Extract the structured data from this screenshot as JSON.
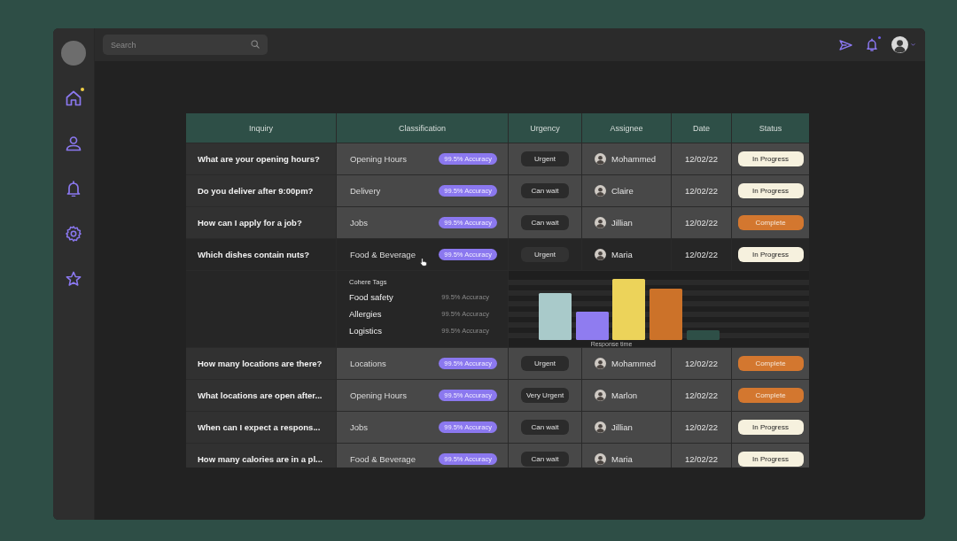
{
  "sidebar": {
    "items": [
      {
        "kind": "home",
        "notification": true
      },
      {
        "kind": "user",
        "notification": false
      },
      {
        "kind": "bell",
        "notification": false
      },
      {
        "kind": "settings",
        "notification": false
      },
      {
        "kind": "star",
        "notification": false
      }
    ]
  },
  "topbar": {
    "search": {
      "placeholder": "Search"
    },
    "actions": [
      {
        "kind": "send",
        "notification": false
      },
      {
        "kind": "bell",
        "notification": true
      }
    ]
  },
  "table": {
    "columns": [
      "Inquiry",
      "Classification",
      "Urgency",
      "Assignee",
      "Date",
      "Status"
    ],
    "rows": [
      {
        "inquiry": "What are your opening hours?",
        "classification": "Opening Hours",
        "accuracy": "99.5% Accuracy",
        "urgency": "Urgent",
        "assignee": "Mohammed",
        "date": "12/02/22",
        "status": {
          "label": "In Progress",
          "kind": "in-progress"
        },
        "selected": false,
        "expanded": false
      },
      {
        "inquiry": "Do you deliver after 9:00pm?",
        "classification": "Delivery",
        "accuracy": "99.5% Accuracy",
        "urgency": "Can wait",
        "assignee": "Claire",
        "date": "12/02/22",
        "status": {
          "label": "In Progress",
          "kind": "in-progress"
        },
        "selected": false,
        "expanded": false
      },
      {
        "inquiry": "How can I apply for a job?",
        "classification": "Jobs",
        "accuracy": "99.5% Accuracy",
        "urgency": "Can wait",
        "assignee": "Jillian",
        "date": "12/02/22",
        "status": {
          "label": "Complete",
          "kind": "complete"
        },
        "selected": false,
        "expanded": false
      },
      {
        "inquiry": "Which dishes contain nuts?",
        "classification": "Food & Beverage",
        "accuracy": "99.5% Accuracy",
        "urgency": "Urgent",
        "assignee": "Maria",
        "date": "12/02/22",
        "status": {
          "label": "In Progress",
          "kind": "in-progress"
        },
        "selected": true,
        "expanded": true,
        "detail": {
          "title": "Cohere Tags",
          "tags": [
            {
              "name": "Food safety",
              "accuracy": "99.5% Accuracy"
            },
            {
              "name": "Allergies",
              "accuracy": "99.5% Accuracy"
            },
            {
              "name": "Logistics",
              "accuracy": "99.5% Accuracy"
            }
          ],
          "chart": {
            "xlabel": "Response time"
          }
        }
      },
      {
        "inquiry": "How many locations are there?",
        "classification": "Locations",
        "accuracy": "99.5% Accuracy",
        "urgency": "Urgent",
        "assignee": "Mohammed",
        "date": "12/02/22",
        "status": {
          "label": "Complete",
          "kind": "complete"
        },
        "selected": false,
        "expanded": false
      },
      {
        "inquiry": "What locations are open after...",
        "classification": "Opening Hours",
        "accuracy": "99.5% Accuracy",
        "urgency": "Very Urgent",
        "assignee": "Marlon",
        "date": "12/02/22",
        "status": {
          "label": "Complete",
          "kind": "complete"
        },
        "selected": false,
        "expanded": false
      },
      {
        "inquiry": "When can I expect a respons...",
        "classification": "Jobs",
        "accuracy": "99.5% Accuracy",
        "urgency": "Can wait",
        "assignee": "Jillian",
        "date": "12/02/22",
        "status": {
          "label": "In Progress",
          "kind": "in-progress"
        },
        "selected": false,
        "expanded": false
      },
      {
        "inquiry": "How many calories are in a pl...",
        "classification": "Food & Beverage",
        "accuracy": "99.5% Accuracy",
        "urgency": "Can wait",
        "assignee": "Maria",
        "date": "12/02/22",
        "status": {
          "label": "In Progress",
          "kind": "in-progress"
        },
        "selected": false,
        "expanded": false
      }
    ]
  }
}
